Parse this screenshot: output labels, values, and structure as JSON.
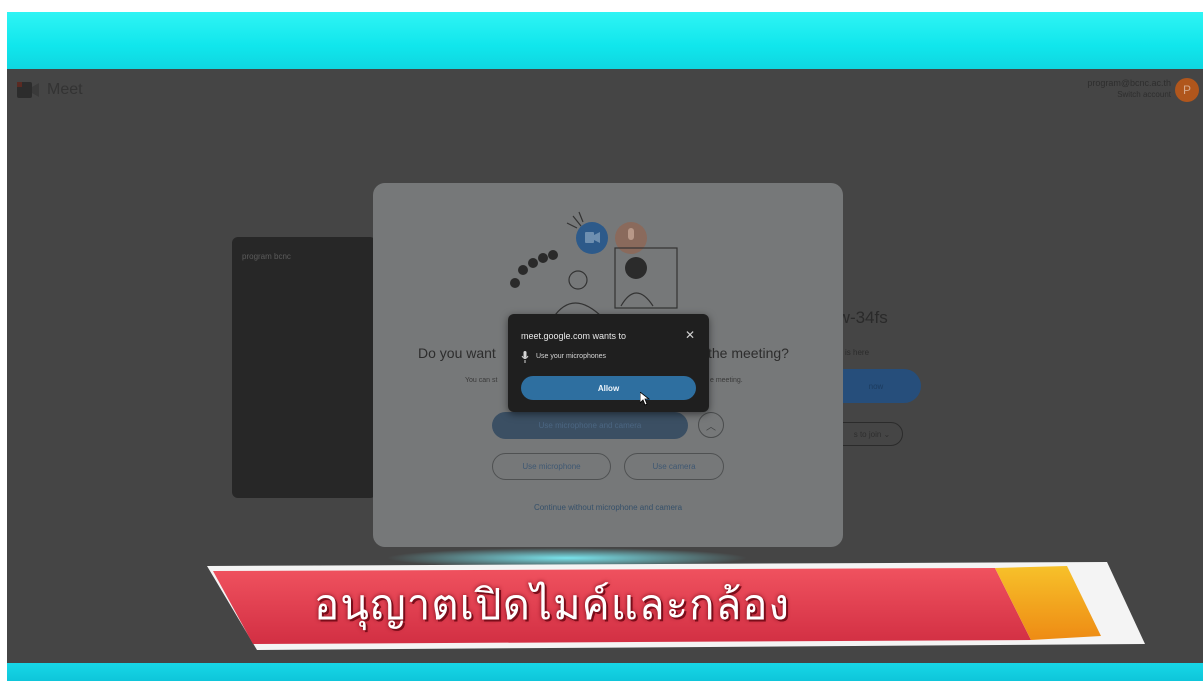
{
  "app": {
    "name": "Meet"
  },
  "account": {
    "email": "program@bcnc.ac.th",
    "switch_label": "Switch account",
    "avatar_letter": "P"
  },
  "preview": {
    "name": "program bcnc"
  },
  "meeting": {
    "code_fragment": "rw-34fs",
    "others_text": "is here",
    "join_label": "now",
    "other_ways_label": "s to join"
  },
  "permission_modal": {
    "heading_left": "Do you want",
    "heading_right": "the meeting?",
    "sub_left": "You can st",
    "sub_right": "e meeting.",
    "mic_cam_label": "Use microphone and camera",
    "use_mic_label": "Use microphone",
    "use_cam_label": "Use camera",
    "continue_label": "Continue without microphone and camera"
  },
  "browser_prompt": {
    "title": "meet.google.com wants to",
    "permission": "Use your microphones",
    "allow_label": "Allow",
    "close_glyph": "✕"
  },
  "caption": {
    "text": "อนุญาตเปิดไมค์และกล้อง"
  },
  "colors": {
    "top_banner": "#14ecf0",
    "caption_red": "#e2414f",
    "caption_orange": "#f2a21a",
    "allow_blue": "#2e6fa0"
  },
  "icons": [
    "meet-logo-icon",
    "mic-icon",
    "camera-icon",
    "chevron-up-icon",
    "chevron-down-icon",
    "close-icon",
    "cursor-icon"
  ]
}
